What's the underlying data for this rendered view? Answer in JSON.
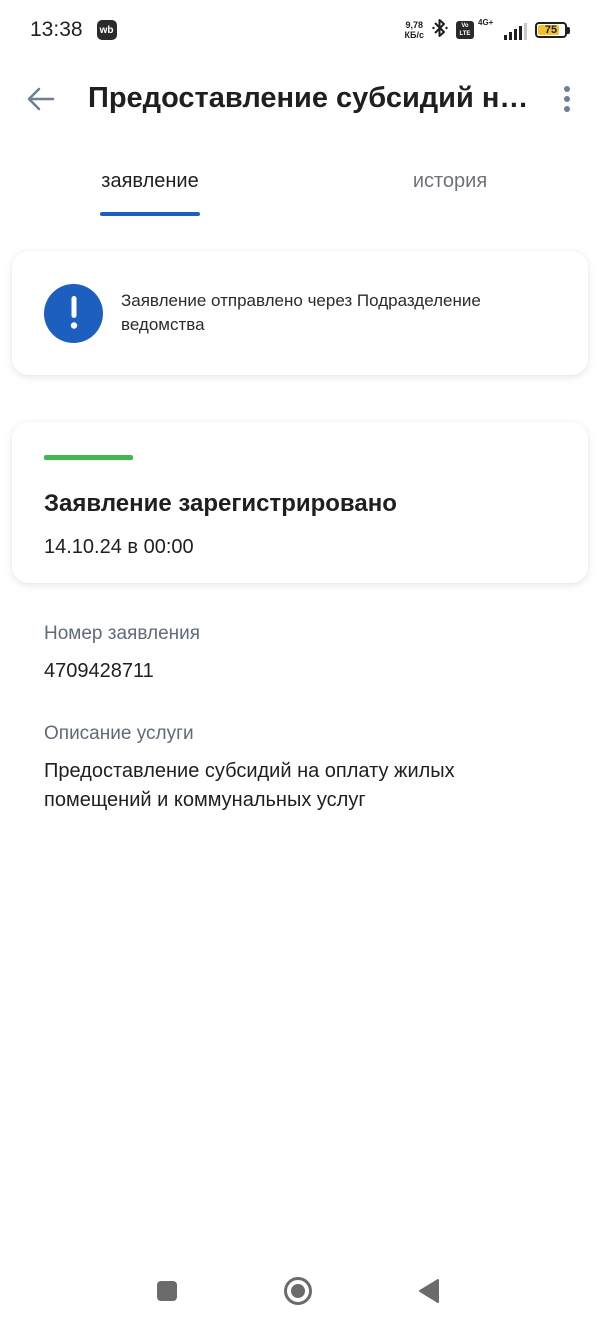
{
  "status_bar": {
    "time": "13:38",
    "wb_badge": "wb",
    "net_speed_value": "9,78",
    "net_speed_unit": "КБ/с",
    "volte_top": "Vo",
    "volte_bottom": "LTE",
    "network": "4G+",
    "battery": "75",
    "battery_level": 0.75,
    "icons": [
      "wb-app-icon",
      "bluetooth-icon",
      "volte-icon",
      "signal-icon",
      "battery-icon"
    ]
  },
  "app_bar": {
    "title": "Предоставление субсидий на...",
    "icons": [
      "back-arrow-icon",
      "more-vertical-icon"
    ]
  },
  "tabs": [
    {
      "label": "заявление",
      "active": true
    },
    {
      "label": "история",
      "active": false
    }
  ],
  "notice": {
    "text": "Заявление отправлено через Подразделение ведомства",
    "icon": "exclamation-icon"
  },
  "status_card": {
    "title": "Заявление зарегистрировано",
    "date": "14.10.24 в 00:00"
  },
  "details": [
    {
      "label": "Номер заявления",
      "value": "4709428711"
    },
    {
      "label": "Описание услуги",
      "value": "Предоставление субсидий на оплату жилых помещений и коммунальных услуг"
    }
  ],
  "colors": {
    "accent_blue": "#1d5fbf",
    "status_green": "#3fb94b",
    "muted_label": "#5f6b7a",
    "battery_yellow": "#f2c230"
  },
  "nav_bar": {
    "icons": [
      "recent-apps-icon",
      "home-icon",
      "back-triangle-icon"
    ]
  }
}
